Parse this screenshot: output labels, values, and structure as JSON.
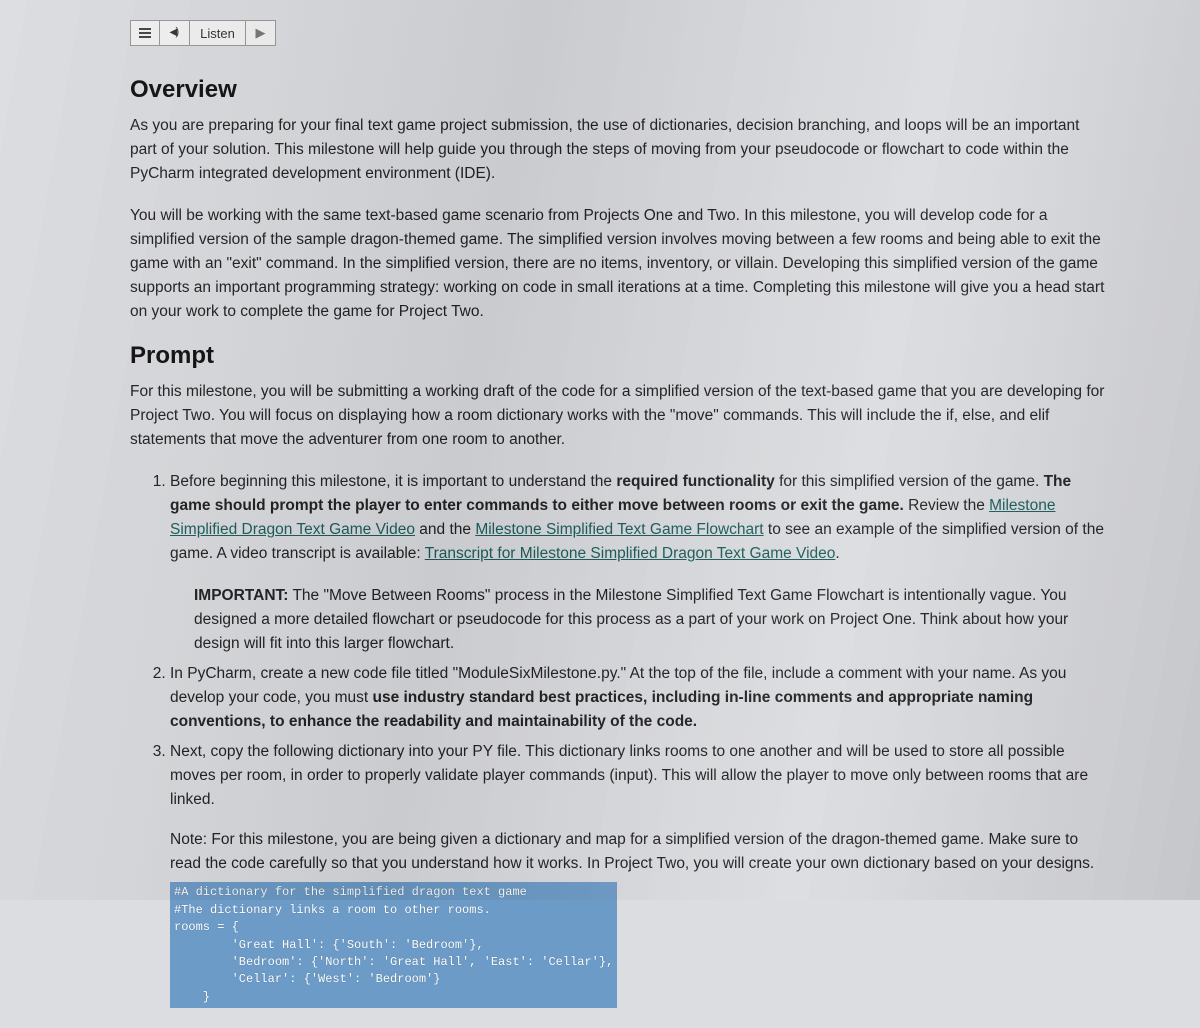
{
  "toolbar": {
    "listen_label": "Listen"
  },
  "overview": {
    "title": "Overview",
    "p1": "As you are preparing for your final text game project submission, the use of dictionaries, decision branching, and loops will be an important part of your solution. This milestone will help guide you through the steps of moving from your pseudocode or flowchart to code within the PyCharm integrated development environment (IDE).",
    "p2": "You will be working with the same text-based game scenario from Projects One and Two. In this milestone, you will develop code for a simplified version of the  sample dragon-themed game. The simplified version involves moving between a few rooms and being able to exit the game with an \"exit\" command. In the simplified version, there are no items, inventory, or villain. Developing this simplified version of the game supports an important programming strategy: working on code in small iterations at a time. Completing this milestone will give you a head start on your work to complete the game for Project Two."
  },
  "prompt": {
    "title": "Prompt",
    "intro": "For this milestone, you will be submitting a working draft of the code for a simplified version of the text-based game that you are developing for Project Two. You will focus on displaying how a room dictionary works with the \"move\" commands. This will include the if, else, and elif statements that move the adventurer from one room to another.",
    "step1_a": "Before beginning this milestone, it is important to understand the ",
    "step1_bold1": "required functionality",
    "step1_b": " for this simplified version of the game. ",
    "step1_bold2": "The game should prompt the player to enter commands to either move between rooms or exit the game.",
    "step1_c": " Review the ",
    "link1": "Milestone Simplified Dragon Text Game Video",
    "step1_d": " and the ",
    "link2": "Milestone Simplified Text Game Flowchart",
    "step1_e": " to see an example of the simplified version of the game. A video transcript is available: ",
    "link3": "Transcript for Milestone Simplified Dragon Text Game Video",
    "step1_f": ".",
    "important_label": "IMPORTANT:",
    "important_text": " The \"Move Between Rooms\" process in the Milestone Simplified Text Game Flowchart is intentionally vague. You designed a more detailed flowchart or pseudocode for this process as a part of your work on Project One. Think about how your design will fit into this larger flowchart.",
    "step2_a": "In PyCharm, create a new code file titled \"ModuleSixMilestone.py.\" At the top of the file, include a comment with your name. As you develop your code, you must ",
    "step2_bold": "use industry standard best practices, including in-line comments and appropriate naming conventions, to enhance the readability and maintainability of the code.",
    "step3": "Next, copy the following dictionary into your PY file. This dictionary links rooms to one another and will be used to store all possible moves per room, in order to properly validate player commands (input). This will allow the player to move only between rooms that are linked.",
    "note": "Note: For this milestone, you are being given a dictionary and map for a simplified version of the dragon-themed game. Make sure to read the code carefully so that you understand how it works. In Project Two, you will create your own dictionary based on your designs.",
    "code": "#A dictionary for the simplified dragon text game\n#The dictionary links a room to other rooms.\nrooms = {\n        'Great Hall': {'South': 'Bedroom'},\n        'Bedroom': {'North': 'Great Hall', 'East': 'Cellar'},\n        'Cellar': {'West': 'Bedroom'}\n    }"
  }
}
